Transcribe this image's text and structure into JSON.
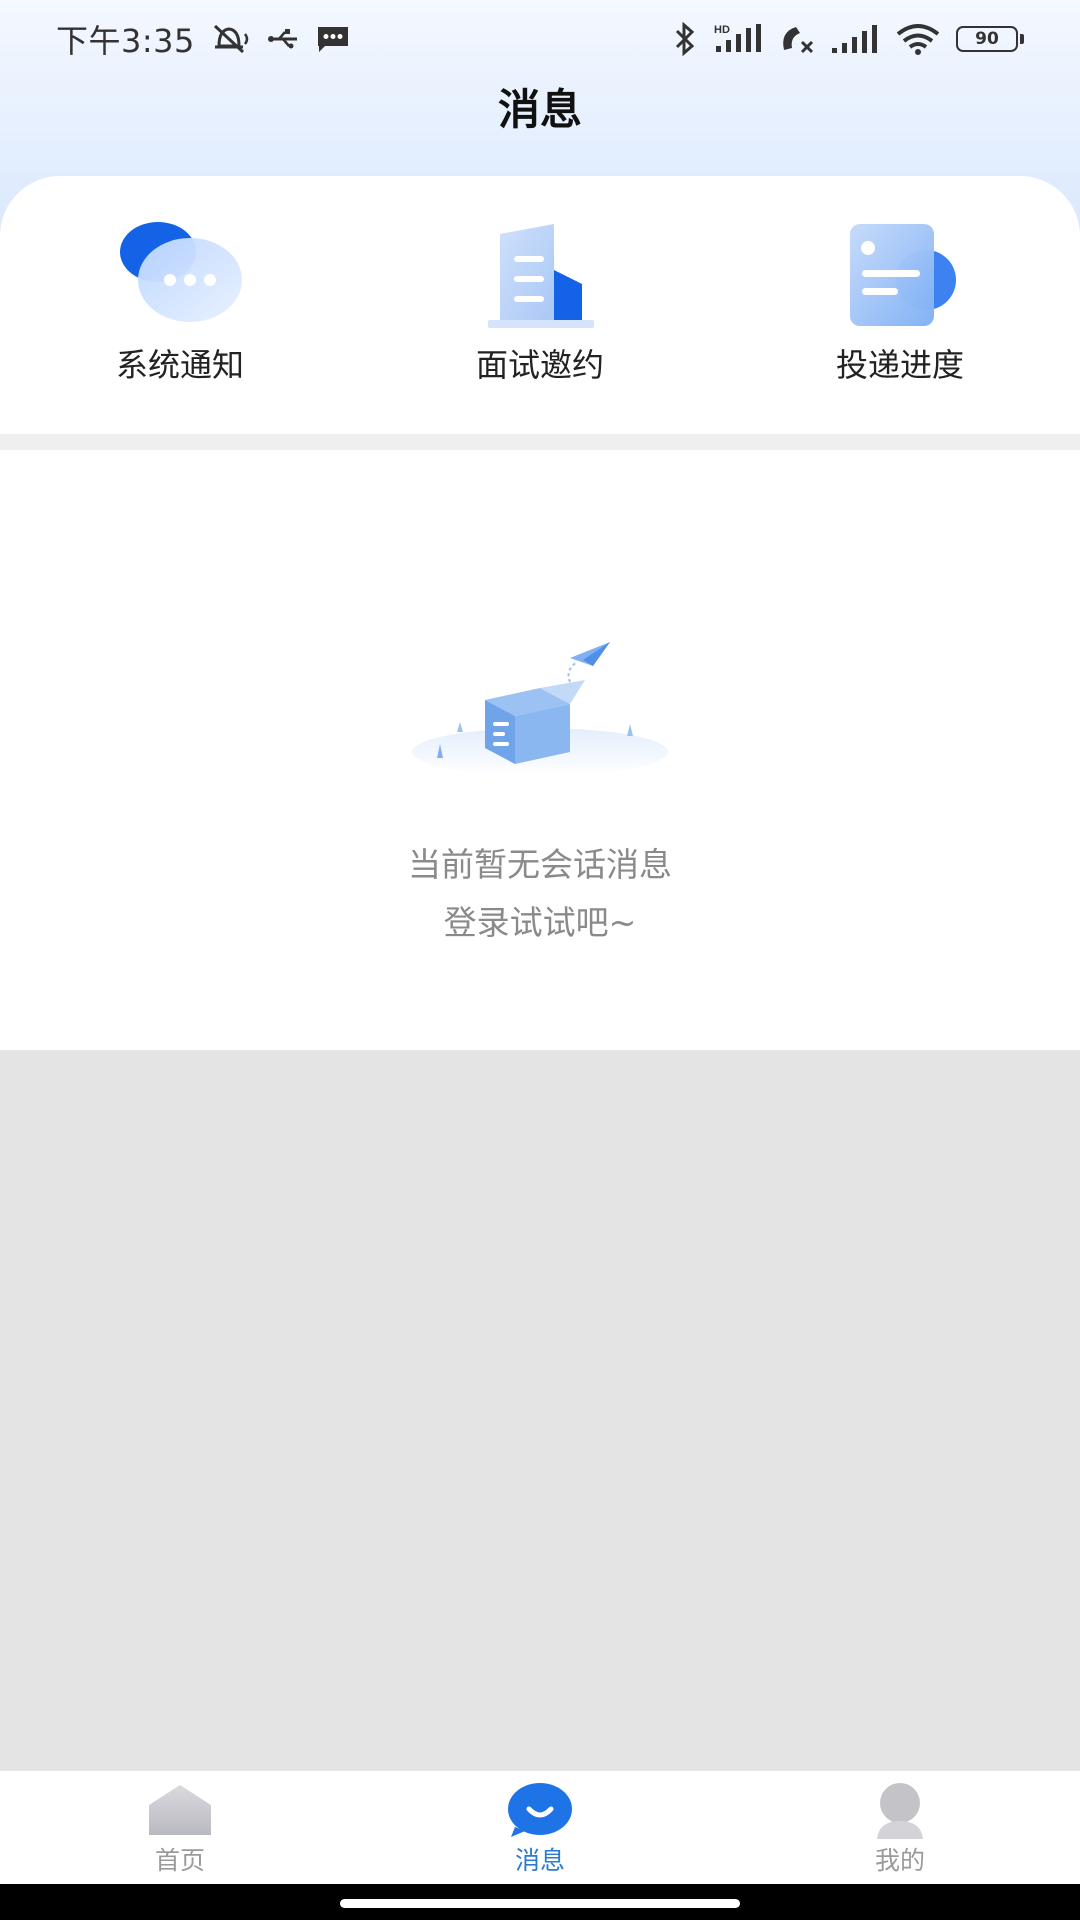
{
  "status_bar": {
    "time": "下午3:35",
    "battery_level": "90",
    "icons": [
      "mute-bell-icon",
      "usb-icon",
      "sms-icon",
      "bluetooth-icon",
      "hd-signal-icon",
      "missed-call-icon",
      "signal-icon",
      "wifi-icon",
      "battery-icon"
    ]
  },
  "header": {
    "title": "消息"
  },
  "shortcuts": [
    {
      "label": "系统通知",
      "icon": "chat-bubbles-icon"
    },
    {
      "label": "面试邀约",
      "icon": "building-icon"
    },
    {
      "label": "投递进度",
      "icon": "document-progress-icon"
    }
  ],
  "empty_state": {
    "line1": "当前暂无会话消息",
    "line2": "登录试试吧~",
    "icon": "empty-box-illustration"
  },
  "bottom_nav": {
    "items": [
      {
        "label": "首页",
        "icon": "home-icon",
        "active": false
      },
      {
        "label": "消息",
        "icon": "message-icon",
        "active": true
      },
      {
        "label": "我的",
        "icon": "profile-icon",
        "active": false
      }
    ]
  },
  "colors": {
    "accent": "#2b7bd3",
    "header_gradient_top": "#f4f8ff",
    "header_gradient_bottom": "#dbe9fd",
    "background": "#e4e4e4"
  }
}
